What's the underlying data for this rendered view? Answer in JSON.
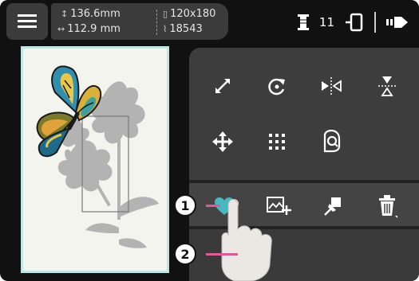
{
  "header": {
    "menu_icon": "hamburger-menu-icon",
    "design_height": "136.6mm",
    "design_width": "112.9 mm",
    "hoop_size": "120x180",
    "stitch_count": "18543",
    "thread_count": "11"
  },
  "canvas": {
    "background": "#f3f4ee",
    "frame_color": "#bfe6e3"
  },
  "tools": [
    {
      "name": "resize-icon"
    },
    {
      "name": "rotate-icon"
    },
    {
      "name": "mirror-horizontal-icon"
    },
    {
      "name": "mirror-vertical-icon"
    },
    {
      "name": "move-icon"
    },
    {
      "name": "grid-icon"
    },
    {
      "name": "outline-icon"
    }
  ],
  "lower_tools": [
    {
      "name": "color-edit-icon"
    },
    {
      "name": "add-image-icon"
    },
    {
      "name": "pin-icon"
    },
    {
      "name": "delete-icon"
    }
  ],
  "callouts": [
    "1",
    "2"
  ],
  "colors": {
    "accent_teal": "#47b8c0",
    "callout_line": "#e05a9a",
    "panel": "#3d3d3d"
  }
}
